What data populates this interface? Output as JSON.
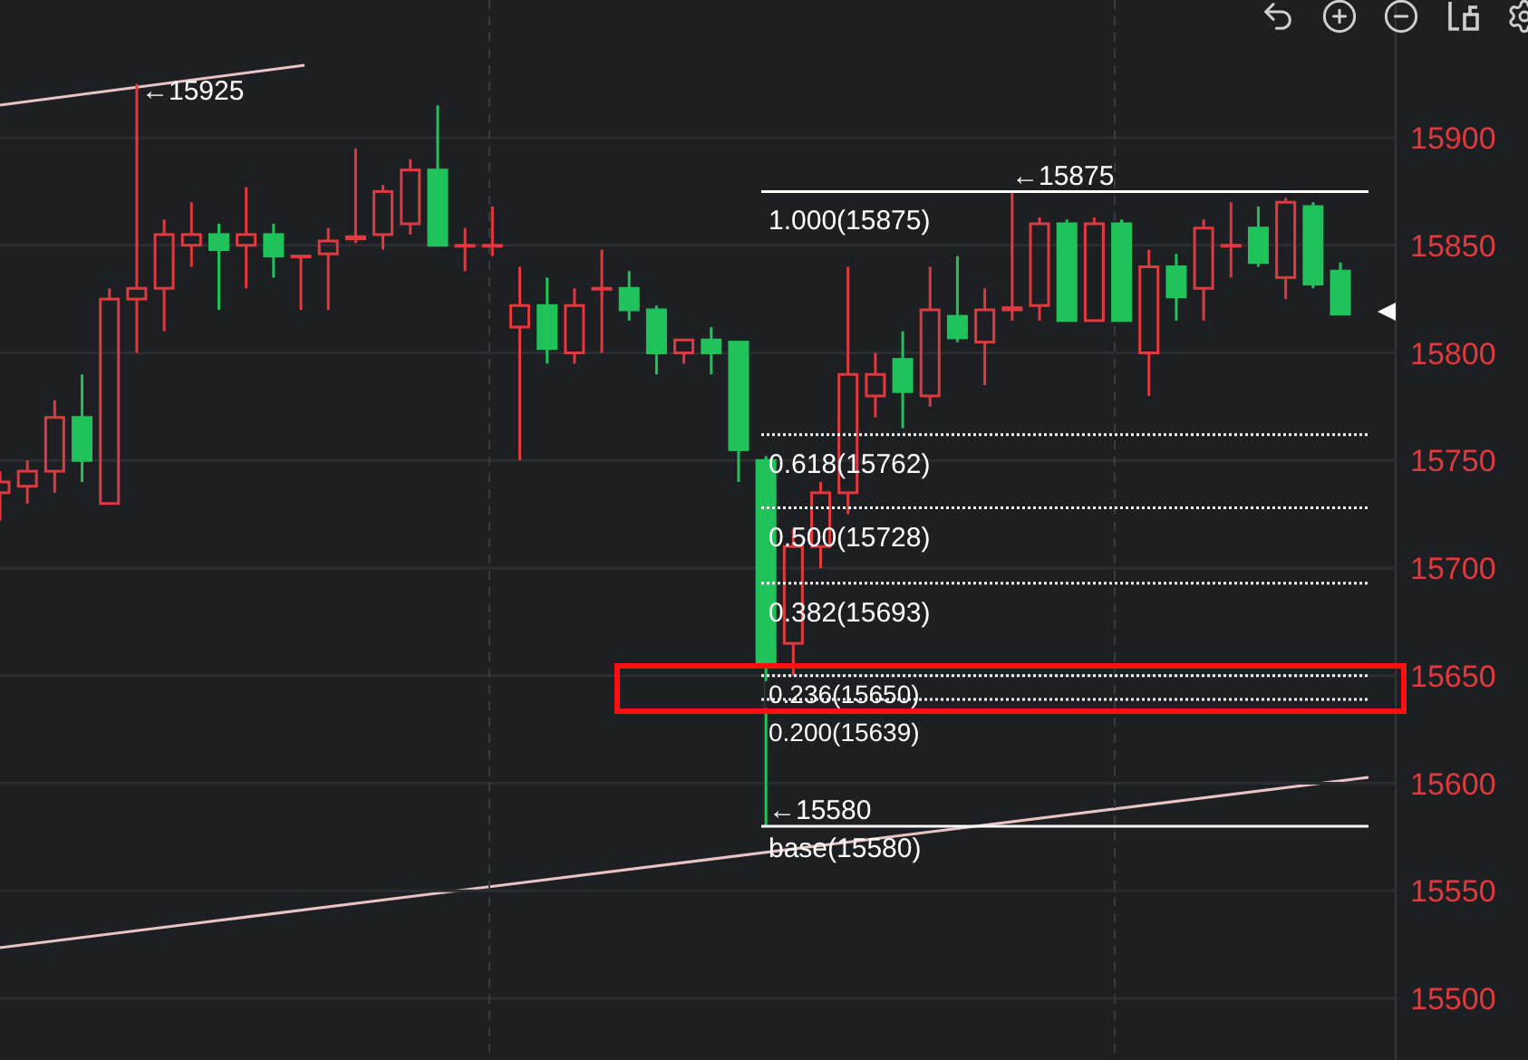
{
  "chart_data": {
    "type": "candlestick",
    "categories": [
      null,
      null,
      null,
      null,
      null,
      null,
      null,
      null,
      null,
      null,
      null,
      null,
      null,
      null,
      null,
      null,
      null,
      null,
      null,
      null,
      null,
      null,
      null,
      null,
      null,
      null,
      null,
      null,
      null,
      null,
      null,
      null,
      null,
      null,
      null,
      null,
      null,
      null,
      null,
      null,
      null,
      null,
      null,
      null,
      null,
      null,
      null,
      null,
      null,
      null
    ],
    "ohlc": [
      [
        15735,
        15745,
        15722,
        15740
      ],
      [
        15738,
        15750,
        15730,
        15745
      ],
      [
        15745,
        15778,
        15735,
        15770
      ],
      [
        15770,
        15790,
        15740,
        15750
      ],
      [
        15730,
        15830,
        15730,
        15825
      ],
      [
        15825,
        15925,
        15800,
        15830
      ],
      [
        15830,
        15862,
        15810,
        15855
      ],
      [
        15850,
        15870,
        15840,
        15855
      ],
      [
        15855,
        15860,
        15820,
        15848
      ],
      [
        15850,
        15877,
        15830,
        15855
      ],
      [
        15855,
        15860,
        15835,
        15845
      ],
      [
        15845,
        15845,
        15820,
        15845
      ],
      [
        15846,
        15858,
        15820,
        15852
      ],
      [
        15853,
        15895,
        15851,
        15854
      ],
      [
        15855,
        15878,
        15848,
        15875
      ],
      [
        15860,
        15890,
        15855,
        15885
      ],
      [
        15885,
        15915,
        15850,
        15850
      ],
      [
        15850,
        15858,
        15838,
        15850
      ],
      [
        15850,
        15868,
        15845,
        15850
      ],
      [
        15812,
        15840,
        15750,
        15822
      ],
      [
        15822,
        15835,
        15795,
        15802
      ],
      [
        15800,
        15830,
        15795,
        15822
      ],
      [
        15830,
        15848,
        15800,
        15830
      ],
      [
        15830,
        15838,
        15815,
        15820
      ],
      [
        15820,
        15822,
        15790,
        15800
      ],
      [
        15800,
        15806,
        15795,
        15806
      ],
      [
        15806,
        15812,
        15790,
        15800
      ],
      [
        15805,
        15805,
        15740,
        15755
      ],
      [
        15750,
        15752,
        15580,
        15655
      ],
      [
        15665,
        15718,
        15650,
        15710
      ],
      [
        15710,
        15740,
        15700,
        15735
      ],
      [
        15735,
        15840,
        15725,
        15790
      ],
      [
        15780,
        15800,
        15770,
        15790
      ],
      [
        15797,
        15810,
        15765,
        15782
      ],
      [
        15780,
        15840,
        15775,
        15820
      ],
      [
        15817,
        15845,
        15805,
        15807
      ],
      [
        15805,
        15830,
        15785,
        15820
      ],
      [
        15820,
        15875,
        15815,
        15821
      ],
      [
        15822,
        15863,
        15815,
        15860
      ],
      [
        15860,
        15862,
        15815,
        15815
      ],
      [
        15815,
        15863,
        15815,
        15860
      ],
      [
        15860,
        15862,
        15815,
        15815
      ],
      [
        15800,
        15848,
        15780,
        15840
      ],
      [
        15840,
        15846,
        15815,
        15826
      ],
      [
        15830,
        15862,
        15815,
        15858
      ],
      [
        15850,
        15870,
        15835,
        15850
      ],
      [
        15858,
        15868,
        15840,
        15842
      ],
      [
        15835,
        15872,
        15825,
        15870
      ],
      [
        15868,
        15870,
        15830,
        15832
      ],
      [
        15838,
        15842,
        15818,
        15818
      ]
    ],
    "yticks": [
      15900,
      15850,
      15800,
      15750,
      15700,
      15650,
      15600,
      15550,
      15500
    ],
    "ylim": [
      15471.4,
      15964
    ],
    "grid": true
  },
  "price_marks": [
    {
      "kind": "high",
      "label": "←15925"
    },
    {
      "kind": "swing_high",
      "label": "←15875"
    },
    {
      "kind": "low",
      "label": "←15580"
    }
  ],
  "fibonacci": {
    "levels": [
      {
        "label": "1.000(15875)",
        "kind": "solid"
      },
      {
        "label": "0.618(15762)",
        "kind": "dotted"
      },
      {
        "label": "0.500(15728)",
        "kind": "dotted"
      },
      {
        "label": "0.382(15693)",
        "kind": "dotted"
      },
      {
        "label": "0.236(15650)",
        "kind": "dotted"
      },
      {
        "label": "0.200(15639)",
        "kind": "dotted"
      },
      {
        "label": "base(15580)",
        "kind": "solid"
      }
    ]
  }
}
